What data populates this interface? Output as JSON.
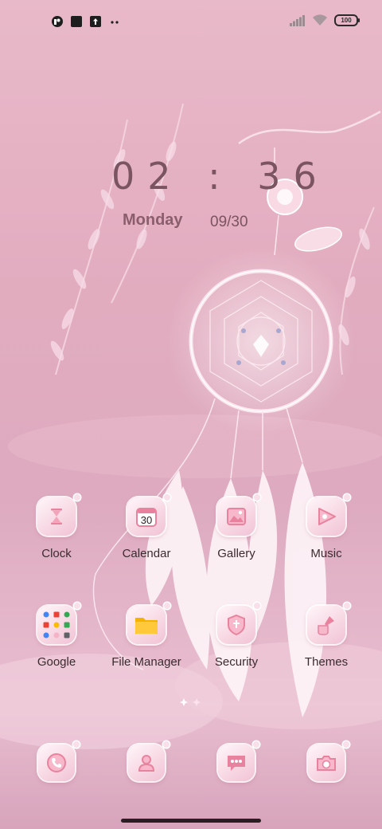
{
  "status_bar": {
    "battery_level": "100",
    "left_icons": [
      "app-notification-icon",
      "square-icon",
      "upload-icon",
      "more-dots-icon"
    ],
    "right_icons": [
      "signal-icon",
      "wifi-icon",
      "battery-icon"
    ]
  },
  "clock_widget": {
    "time": "02 : 36",
    "day": "Monday",
    "date": "09/30"
  },
  "apps": [
    {
      "label": "Clock",
      "icon": "hourglass-icon"
    },
    {
      "label": "Calendar",
      "icon": "calendar-icon",
      "badge": "30"
    },
    {
      "label": "Gallery",
      "icon": "image-icon"
    },
    {
      "label": "Music",
      "icon": "music-icon"
    },
    {
      "label": "Google",
      "icon": "google-folder-icon"
    },
    {
      "label": "File Manager",
      "icon": "folder-icon"
    },
    {
      "label": "Security",
      "icon": "shield-icon"
    },
    {
      "label": "Themes",
      "icon": "paintbrush-icon"
    }
  ],
  "dock": [
    {
      "icon": "phone-icon"
    },
    {
      "icon": "contacts-icon"
    },
    {
      "icon": "messages-icon"
    },
    {
      "icon": "camera-icon"
    }
  ],
  "colors": {
    "background": "#e2acbf",
    "icon_accent": "#e9829f",
    "text": "#3b2b30",
    "clock_text": "#7a5460"
  }
}
